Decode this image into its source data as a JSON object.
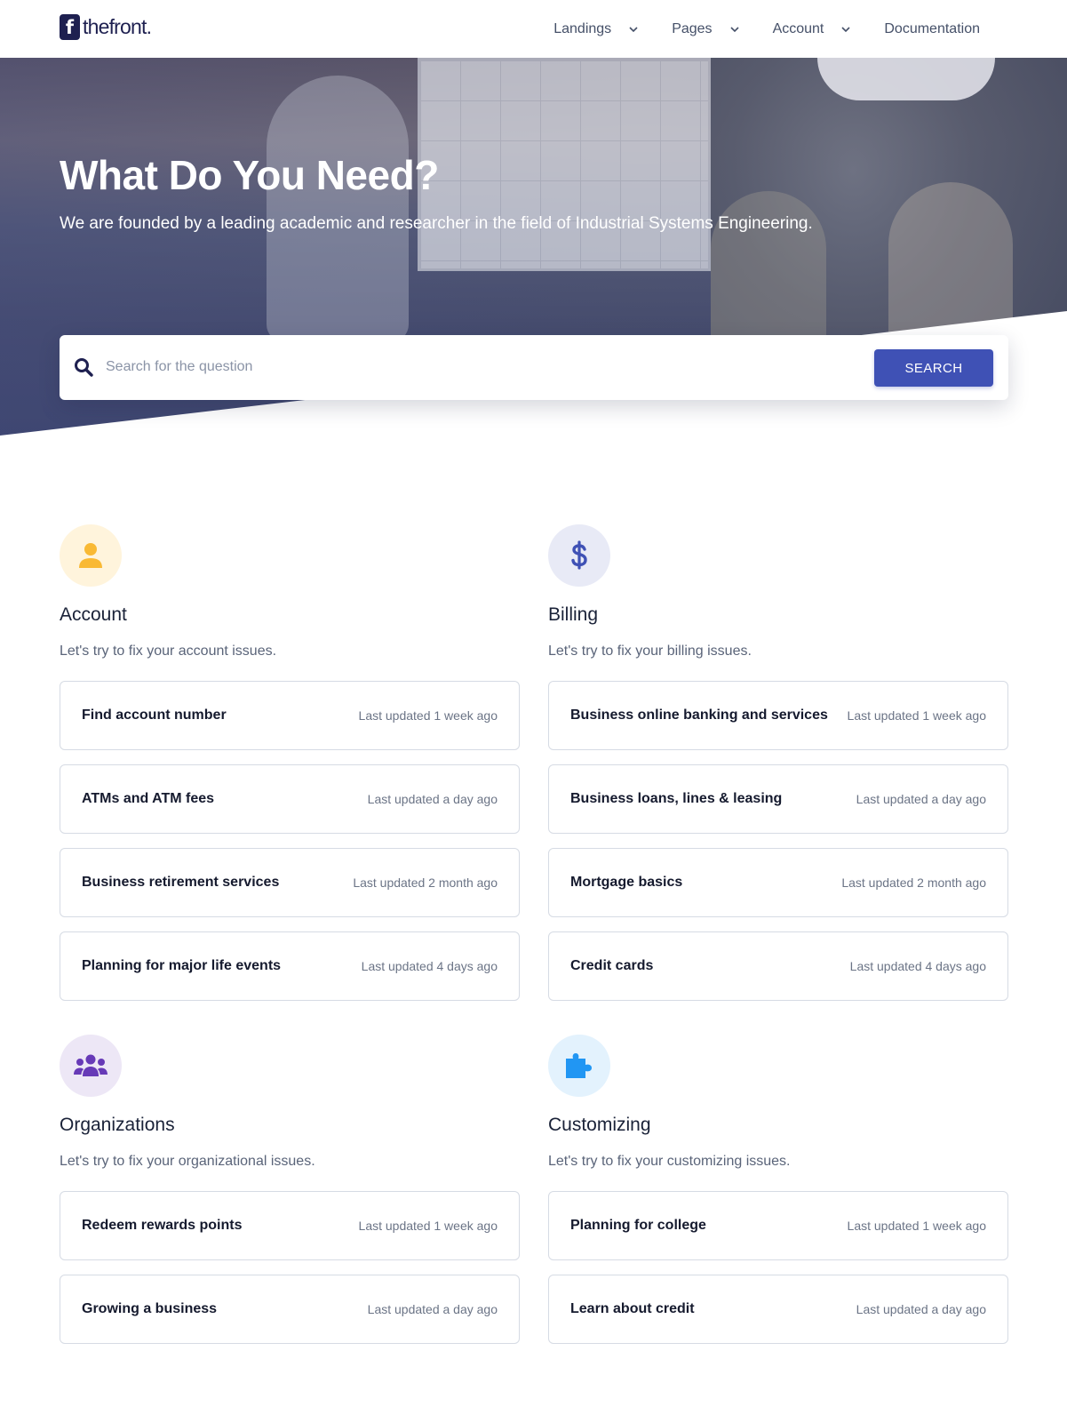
{
  "brand": {
    "logo_letter": "f",
    "name": "thefront."
  },
  "nav": {
    "items": [
      {
        "label": "Landings",
        "has_dropdown": true
      },
      {
        "label": "Pages",
        "has_dropdown": true
      },
      {
        "label": "Account",
        "has_dropdown": true
      },
      {
        "label": "Documentation",
        "has_dropdown": false
      }
    ]
  },
  "hero": {
    "title": "What Do You Need?",
    "subtitle": "We are founded by a leading academic and researcher in the field of Industrial Systems Engineering.",
    "search_placeholder": "Search for the question",
    "search_button": "SEARCH"
  },
  "categories": [
    {
      "title": "Account",
      "icon": "user-icon",
      "description": "Let's try to fix your account issues.",
      "articles": [
        {
          "title": "Find account number",
          "updated": "Last updated 1 week ago"
        },
        {
          "title": "ATMs and ATM fees",
          "updated": "Last updated a day ago"
        },
        {
          "title": "Business retirement services",
          "updated": "Last updated 2 month ago"
        },
        {
          "title": "Planning for major life events",
          "updated": "Last updated 4 days ago"
        }
      ]
    },
    {
      "title": "Billing",
      "icon": "dollar-icon",
      "description": "Let's try to fix your billing issues.",
      "articles": [
        {
          "title": "Business online banking and services",
          "updated": "Last updated 1 week ago"
        },
        {
          "title": "Business loans, lines & leasing",
          "updated": "Last updated a day ago"
        },
        {
          "title": "Mortgage basics",
          "updated": "Last updated 2 month ago"
        },
        {
          "title": "Credit cards",
          "updated": "Last updated 4 days ago"
        }
      ]
    },
    {
      "title": "Organizations",
      "icon": "users-icon",
      "description": "Let's try to fix your organizational issues.",
      "articles": [
        {
          "title": "Redeem rewards points",
          "updated": "Last updated 1 week ago"
        },
        {
          "title": "Growing a business",
          "updated": "Last updated a day ago"
        }
      ]
    },
    {
      "title": "Customizing",
      "icon": "puzzle-icon",
      "description": "Let's try to fix your customizing issues.",
      "articles": [
        {
          "title": "Planning for college",
          "updated": "Last updated 1 week ago"
        },
        {
          "title": "Learn about credit",
          "updated": "Last updated a day ago"
        }
      ]
    }
  ],
  "colors": {
    "primary": "#3f51b5",
    "account_icon_bg": "#fff4dc",
    "account_icon": "#f9b934",
    "billing_icon_bg": "#e8eaf6",
    "billing_icon": "#3f51b5",
    "org_icon_bg": "#ede7f6",
    "org_icon": "#673ab7",
    "custom_icon_bg": "#e3f2fd",
    "custom_icon": "#2196f3"
  }
}
